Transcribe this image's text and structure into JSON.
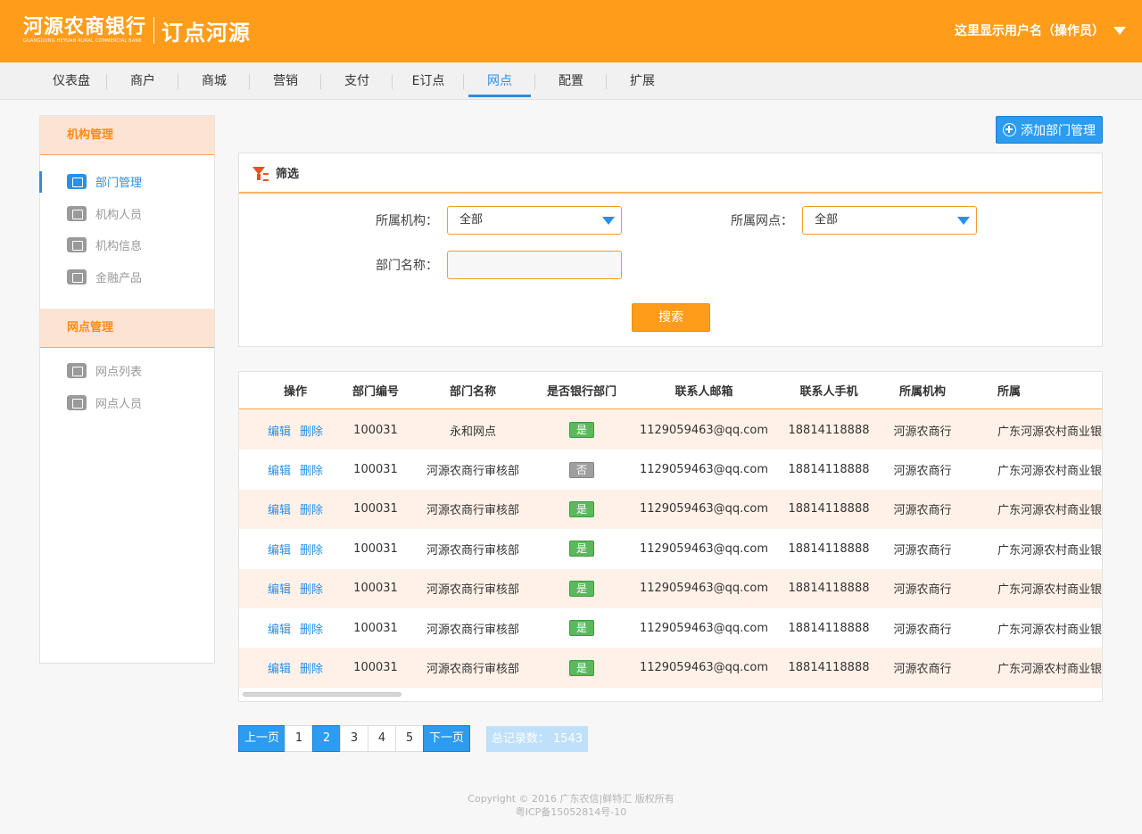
{
  "header": {
    "bank_name": "河源农商银行",
    "bank_name_en": "GUANGDONG HEYUAN RURAL COMMERCIAL BANK",
    "app_name": "订点河源",
    "user": "这里显示用户名（操作员）"
  },
  "nav": {
    "items": [
      "仪表盘",
      "商户",
      "商城",
      "营销",
      "支付",
      "E订点",
      "网点",
      "配置",
      "扩展"
    ],
    "active": "网点"
  },
  "sidebar": {
    "group1": {
      "title": "机构管理",
      "items": [
        {
          "label": "部门管理",
          "icon": "org-chart-icon"
        },
        {
          "label": "机构人员",
          "icon": "person-icon"
        },
        {
          "label": "机构信息",
          "icon": "document-icon"
        },
        {
          "label": "金融产品",
          "icon": "money-icon"
        }
      ]
    },
    "group2": {
      "title": "网点管理",
      "items": [
        {
          "label": "网点列表",
          "icon": "network-icon"
        },
        {
          "label": "网点人员",
          "icon": "contact-card-icon"
        }
      ]
    }
  },
  "toolbar": {
    "add_label": "添加部门管理"
  },
  "filter": {
    "title": "筛选",
    "org_label": "所属机构：",
    "org_value": "全部",
    "branch_label": "所属网点：",
    "branch_value": "全部",
    "dept_label": "部门名称：",
    "dept_value": "",
    "search_label": "搜索"
  },
  "table": {
    "columns": [
      "操作",
      "部门编号",
      "部门名称",
      "是否银行部门",
      "联系人邮箱",
      "联系人手机",
      "所属机构",
      "所属"
    ],
    "edit_label": "编辑",
    "delete_label": "删除",
    "rows": [
      {
        "id": "100031",
        "name": "永和网点",
        "bank": "是",
        "email": "1129059463@qq.com",
        "phone": "18814118888",
        "org": "河源农商行",
        "org2": "广东河源农村商业银行"
      },
      {
        "id": "100031",
        "name": "河源农商行审核部",
        "bank": "否",
        "email": "1129059463@qq.com",
        "phone": "18814118888",
        "org": "河源农商行",
        "org2": "广东河源农村商业银行"
      },
      {
        "id": "100031",
        "name": "河源农商行审核部",
        "bank": "是",
        "email": "1129059463@qq.com",
        "phone": "18814118888",
        "org": "河源农商行",
        "org2": "广东河源农村商业银行"
      },
      {
        "id": "100031",
        "name": "河源农商行审核部",
        "bank": "是",
        "email": "1129059463@qq.com",
        "phone": "18814118888",
        "org": "河源农商行",
        "org2": "广东河源农村商业银行"
      },
      {
        "id": "100031",
        "name": "河源农商行审核部",
        "bank": "是",
        "email": "1129059463@qq.com",
        "phone": "18814118888",
        "org": "河源农商行",
        "org2": "广东河源农村商业银行"
      },
      {
        "id": "100031",
        "name": "河源农商行审核部",
        "bank": "是",
        "email": "1129059463@qq.com",
        "phone": "18814118888",
        "org": "河源农商行",
        "org2": "广东河源农村商业银行"
      },
      {
        "id": "100031",
        "name": "河源农商行审核部",
        "bank": "是",
        "email": "1129059463@qq.com",
        "phone": "18814118888",
        "org": "河源农商行",
        "org2": "广东河源农村商业银行"
      }
    ]
  },
  "pagination": {
    "prev": "上一页",
    "pages": [
      "1",
      "2",
      "3",
      "4",
      "5"
    ],
    "current": "2",
    "next": "下一页",
    "total": "总记录数： 1543"
  },
  "footer": {
    "copyright": "Copyright © 2016 广东农信|鲜特汇 版权所有",
    "icp": "粤ICP备15052814号-10"
  },
  "colors": {
    "brand_orange": "#ff9c1a",
    "accent_blue": "#2b8fe4",
    "yes_green": "#5cb85c",
    "no_gray": "#9e9e9e"
  }
}
